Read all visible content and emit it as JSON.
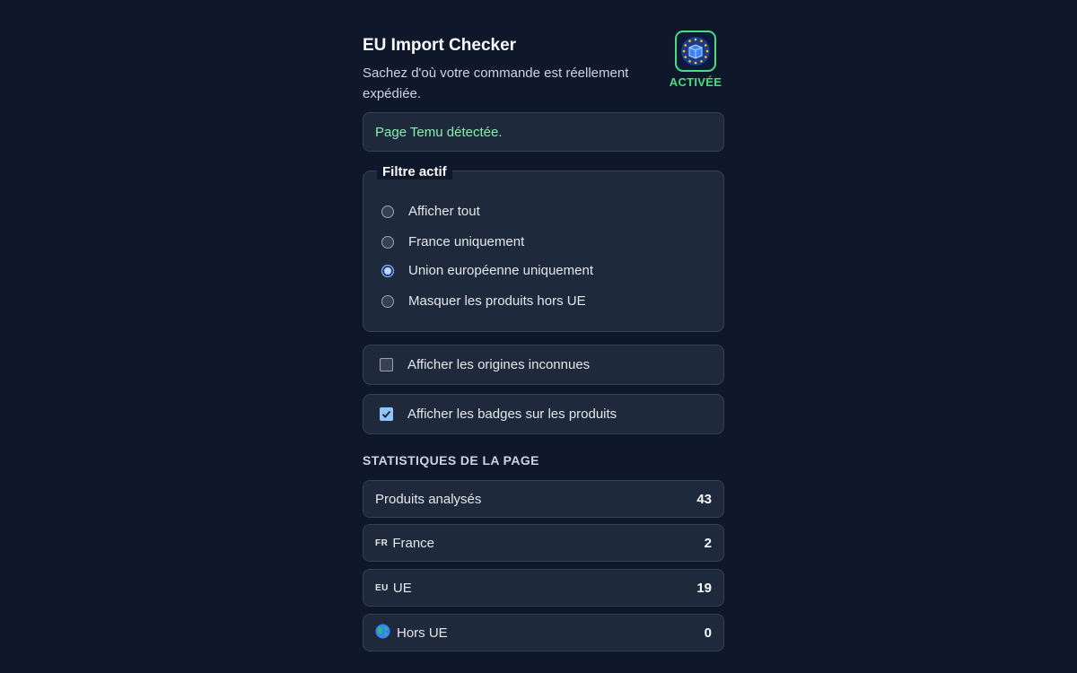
{
  "header": {
    "title": "EU Import Checker",
    "subtitle": "Sachez d'où votre commande est réellement expédiée.",
    "status": "ACTIVÉE",
    "logo_icon": "eu-stars-box-icon"
  },
  "detection": {
    "message": "Page Temu détectée."
  },
  "filter": {
    "legend": "Filtre actif",
    "options": [
      {
        "label": "Afficher tout",
        "checked": false
      },
      {
        "label": "France uniquement",
        "checked": false
      },
      {
        "label": "Union européenne uniquement",
        "checked": true
      },
      {
        "label": "Masquer les produits hors UE",
        "checked": false
      }
    ]
  },
  "toggles": [
    {
      "label": "Afficher les origines inconnues",
      "checked": false
    },
    {
      "label": "Afficher les badges sur les produits",
      "checked": true
    }
  ],
  "stats": {
    "title": "STATISTIQUES DE LA PAGE",
    "rows": [
      {
        "code": "",
        "label": "Produits analysés",
        "value": "43"
      },
      {
        "code": "FR",
        "label": "France",
        "value": "2"
      },
      {
        "code": "EU",
        "label": "UE",
        "value": "19"
      },
      {
        "code": "",
        "label": "Hors UE",
        "value": "0",
        "icon": "globe-icon"
      }
    ]
  },
  "colors": {
    "background": "#0f172a",
    "card": "#1e293b",
    "accent_green": "#4ade80",
    "accent_blue": "#93c5fd"
  }
}
